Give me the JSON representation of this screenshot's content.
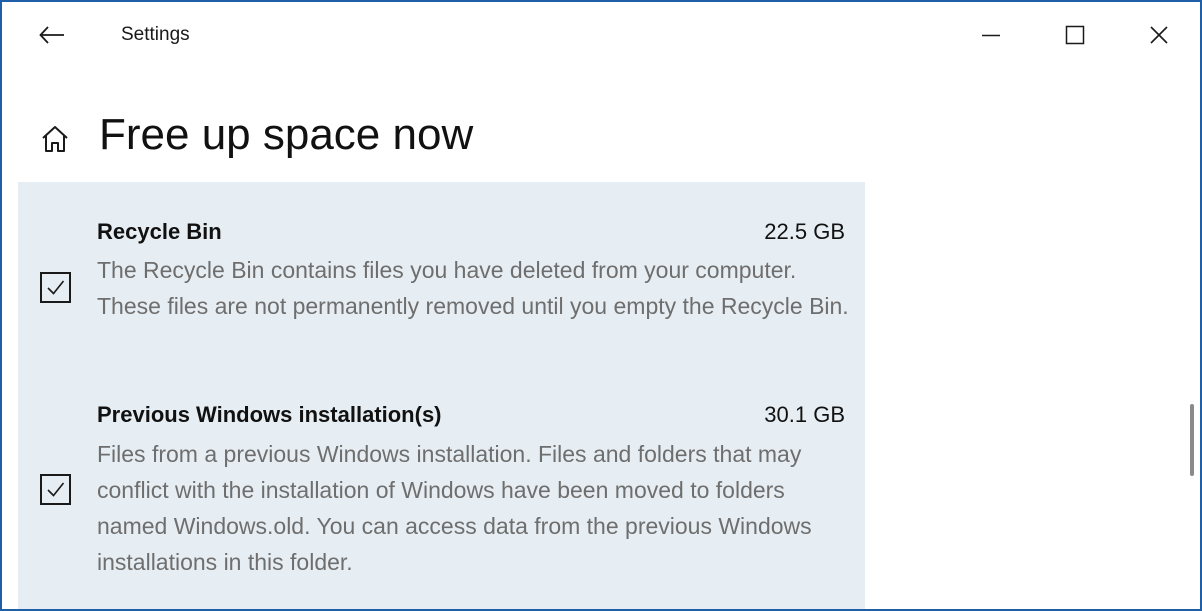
{
  "window": {
    "title": "Settings",
    "back_icon": "arrow-left-icon",
    "minimize_icon": "minimize-icon",
    "maximize_icon": "maximize-icon",
    "close_icon": "close-icon",
    "accent_border": "#1f5fa8"
  },
  "header": {
    "home_icon": "home-icon",
    "page_title": "Free up space now"
  },
  "items": [
    {
      "name": "Recycle Bin",
      "size": "22.5 GB",
      "description": "The Recycle Bin contains files you have deleted from your computer. These files are not permanently removed until you empty the Recycle Bin.",
      "checked": true
    },
    {
      "name": "Previous Windows installation(s)",
      "size": "30.1 GB",
      "description": "Files from a previous Windows installation.  Files and folders that may conflict with the installation of Windows have been moved to folders named Windows.old.  You can access data from the previous Windows installations in this folder.",
      "checked": true
    }
  ],
  "colors": {
    "panel_background": "#e7eef3",
    "description_text": "#6e6e6e"
  }
}
